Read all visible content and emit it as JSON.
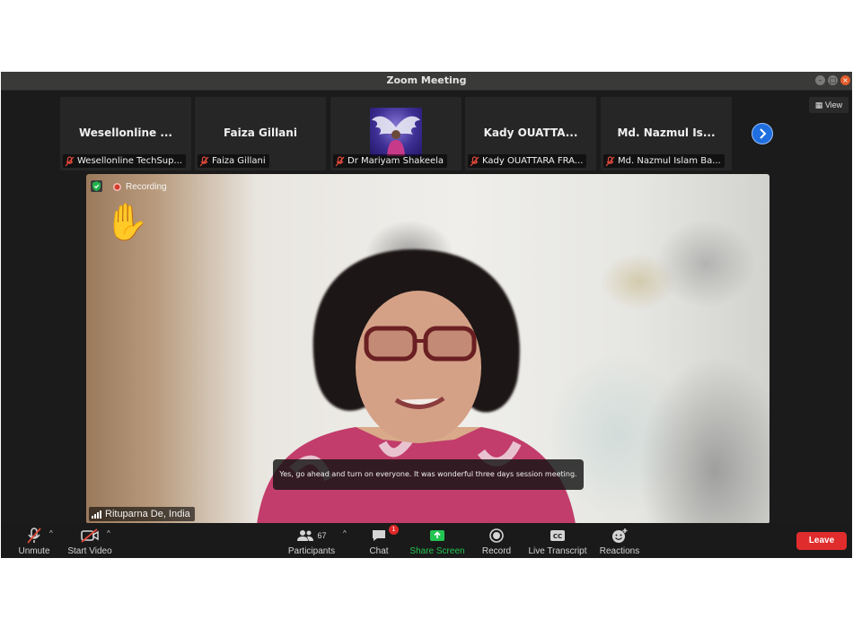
{
  "window": {
    "title": "Zoom Meeting"
  },
  "view_button": {
    "label": "View"
  },
  "participants_strip": [
    {
      "display_name": "Wesellonline ...",
      "label": "Wesellonline TechSup...",
      "has_video": false
    },
    {
      "display_name": "Faiza Gillani",
      "label": "Faiza Gillani",
      "has_video": false
    },
    {
      "display_name": "",
      "label": "Dr Mariyam Shakeela",
      "has_video": true
    },
    {
      "display_name": "Kady OUATTA...",
      "label": "Kady OUATTARA FRA...",
      "has_video": false
    },
    {
      "display_name": "Md. Nazmul Is...",
      "label": "Md. Nazmul Islam Ba...",
      "has_video": false
    }
  ],
  "main_video": {
    "recording_label": "Recording",
    "raised_hand": "✋",
    "caption": "Yes, go ahead and turn on everyone. It was wonderful three days session meeting.",
    "speaker_name": "Rituparna De, India"
  },
  "toolbar": {
    "unmute": "Unmute",
    "start_video": "Start Video",
    "participants": "Participants",
    "participants_count": "67",
    "chat": "Chat",
    "chat_badge": "1",
    "share_screen": "Share Screen",
    "record": "Record",
    "live_transcript": "Live Transcript",
    "reactions": "Reactions",
    "leave": "Leave"
  },
  "colors": {
    "accent_blue": "#1f6fe0",
    "share_green": "#23c552",
    "leave_red": "#e02c2c",
    "muted_red": "#e0483a"
  }
}
